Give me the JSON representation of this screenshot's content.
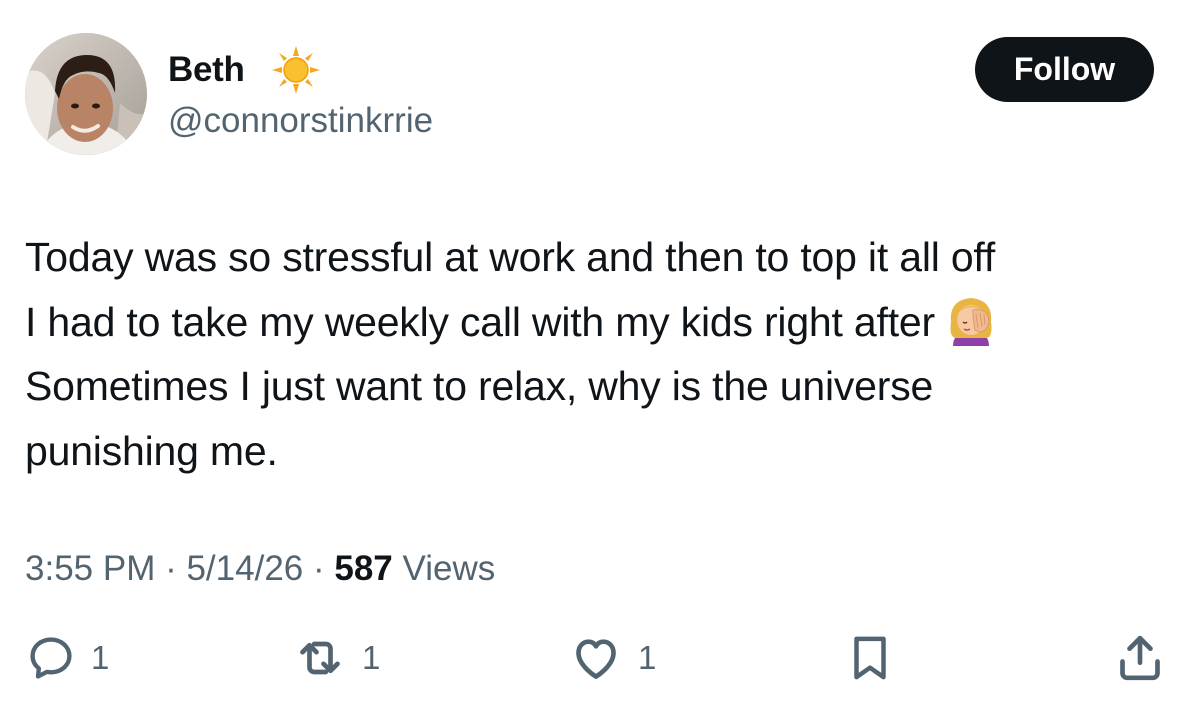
{
  "author": {
    "display_name": "Beth",
    "handle": "@connorstinkrrie",
    "name_emoji": "sun-icon",
    "avatar": "profile-photo"
  },
  "follow_button": {
    "label": "Follow"
  },
  "tweet": {
    "lines": [
      "Today was so stressful at work and then to top it all off",
      "I had to take my weekly call with my kids right after",
      "Sometimes I just want to relax, why is the universe",
      "punishing me."
    ],
    "inline_emoji": "facepalm-icon"
  },
  "meta": {
    "time": "3:55 PM",
    "separator": " · ",
    "date": "5/14/26",
    "views_count": "587",
    "views_label": " Views"
  },
  "actions": {
    "reply_count": "1",
    "retweet_count": "1",
    "like_count": "1"
  },
  "colors": {
    "text_primary": "#0f1419",
    "text_secondary": "#536471",
    "follow_bg": "#0f1419",
    "follow_text": "#ffffff",
    "background": "#ffffff"
  }
}
